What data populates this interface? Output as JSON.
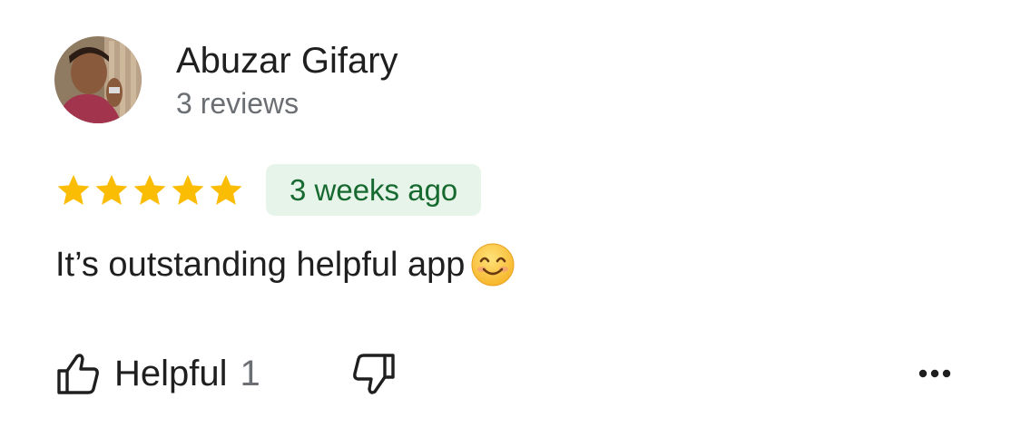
{
  "review": {
    "author": {
      "name": "Abuzar Gifary",
      "review_count": "3 reviews"
    },
    "rating": 5,
    "max_rating": 5,
    "date": "3 weeks ago",
    "text": "It’s outstanding helpful app",
    "emoji": "smiling-face-icon"
  },
  "actions": {
    "helpful_label": "Helpful",
    "helpful_count": "1",
    "not_helpful_icon": "thumbs-down-icon",
    "more_icon": "more-options-icon"
  },
  "colors": {
    "star": "#FBBC04",
    "date_chip_bg": "#E6F4EA",
    "date_chip_text": "#16692F",
    "secondary_text": "#6B6F73"
  }
}
